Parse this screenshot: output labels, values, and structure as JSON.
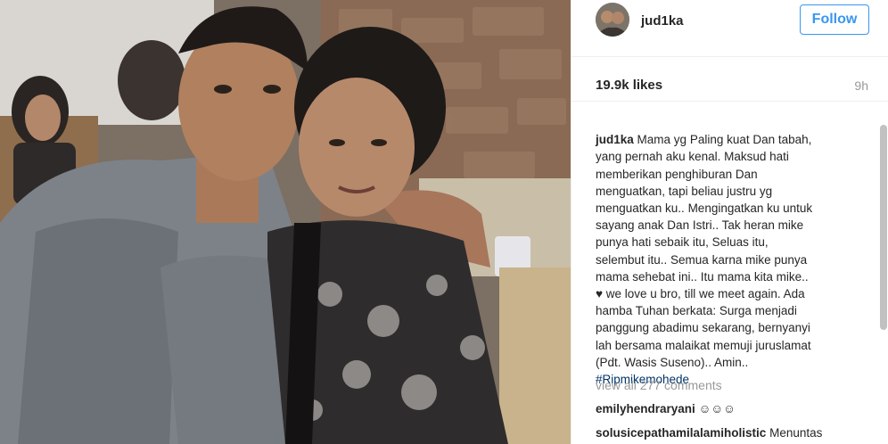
{
  "post": {
    "username": "jud1ka",
    "follow_label": "Follow",
    "likes": "19.9k likes",
    "time_ago": "9h",
    "caption_lines": [
      "Mama yg Paling kuat Dan tabah,",
      "yang pernah aku kenal. Maksud hati",
      "memberikan penghiburan Dan",
      "menguatkan, tapi beliau justru yg",
      "menguatkan ku.. Mengingatkan ku untuk",
      "sayang anak Dan Istri.. Tak heran mike",
      "punya hati sebaik itu, Seluas itu,",
      "selembut itu.. Semua karna mike punya",
      "mama sehebat ini.. Itu mama kita mike..",
      "♥ we love u bro, till we meet again. Ada",
      "hamba Tuhan berkata: Surga menjadi",
      "panggung abadimu sekarang, bernyanyi",
      "lah bersama malaikat memuji juruslamat",
      "(Pdt. Wasis Suseno).. Amin.."
    ],
    "hashtag": "#Ripmikemohede",
    "view_all_comments": "view all 277 comments",
    "comments": [
      {
        "user": "emilyhendraryani",
        "text": "☺☺☺"
      },
      {
        "user": "solusicepathamilalamiholistic",
        "text": "Menuntas"
      }
    ]
  },
  "colors": {
    "accent": "#3897f0",
    "muted": "#999999",
    "text": "#262626",
    "hashtag": "#003569"
  }
}
